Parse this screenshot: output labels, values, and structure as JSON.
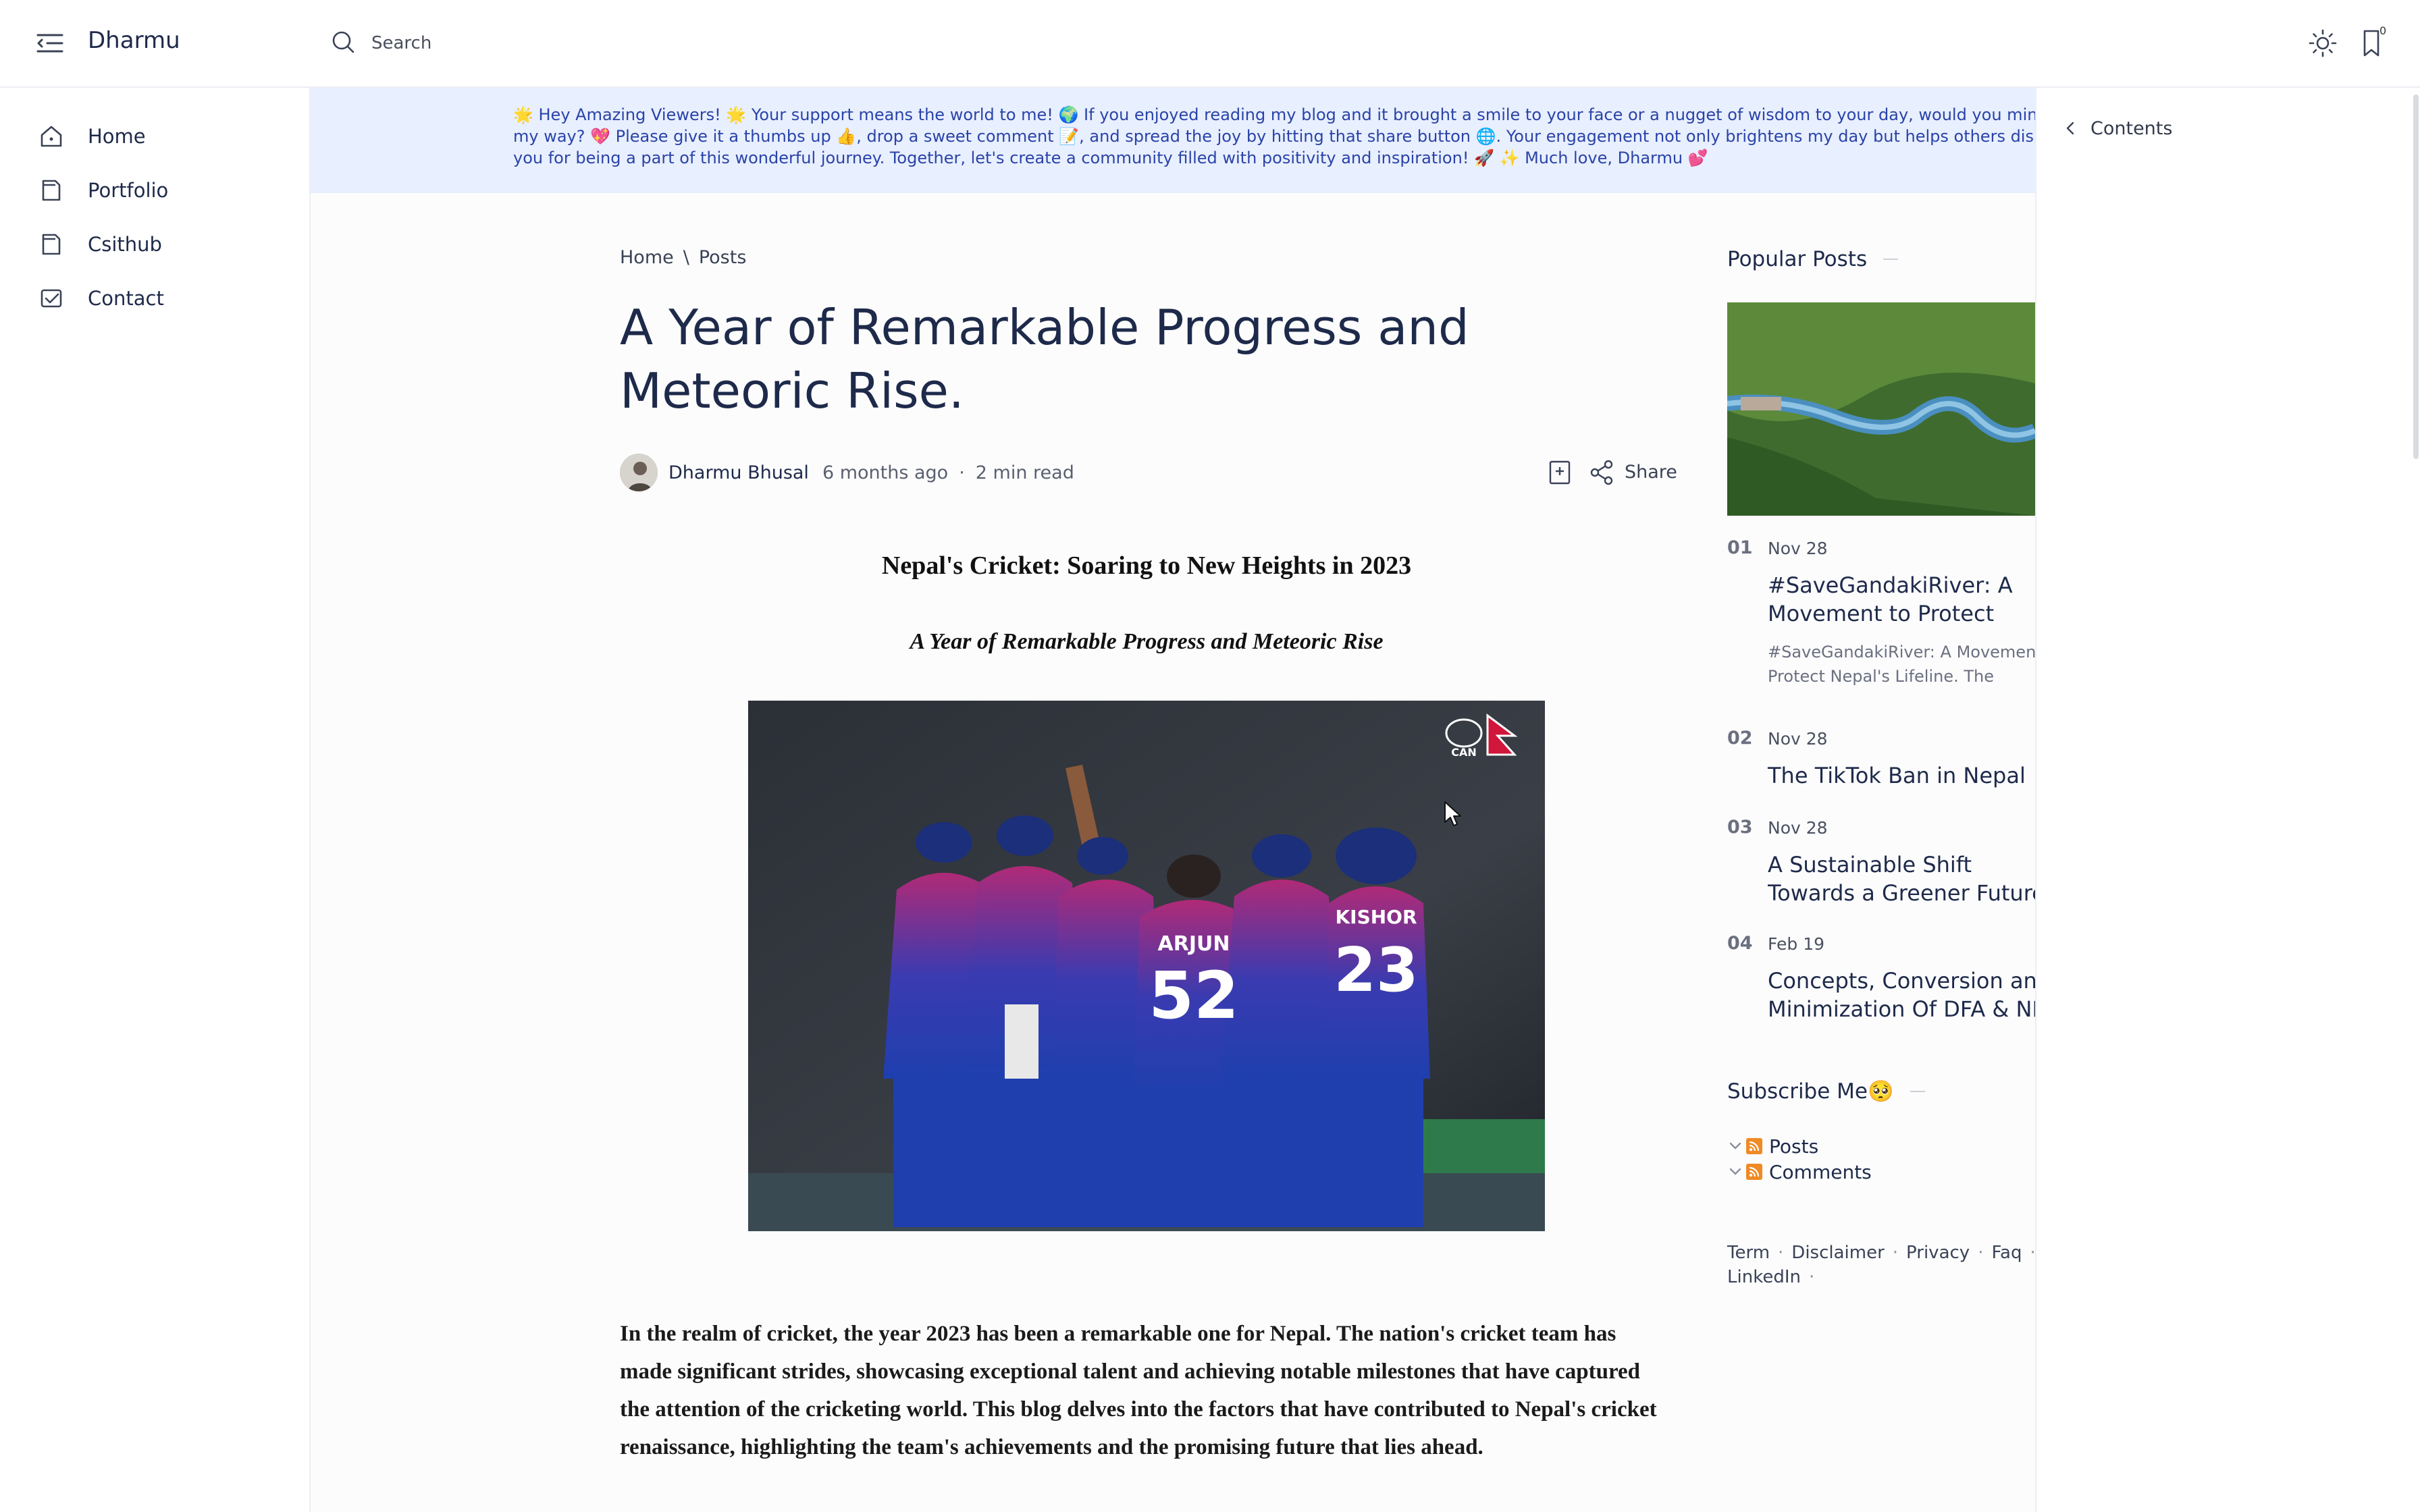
{
  "app": {
    "site_title": "Dharmu",
    "search_placeholder": "Search",
    "bookmark_count": "0"
  },
  "sidebar": {
    "items": [
      {
        "label": "Home",
        "icon": "home-icon"
      },
      {
        "label": "Portfolio",
        "icon": "portfolio-icon"
      },
      {
        "label": "Csithub",
        "icon": "csithub-icon"
      },
      {
        "label": "Contact",
        "icon": "contact-icon"
      }
    ]
  },
  "banner": {
    "text": "🌟 Hey Amazing Viewers! 🌟 Your support means the world to me! 🌍 If you enjoyed reading my blog and it brought a smile to your face or a nugget of wisdom to your day, would you mind sp love my way? 💖 Please give it a thumbs up 👍, drop a sweet comment 📝, and spread the joy by hitting that share button 🌐. Your engagement not only brightens my day but helps others dis too! Thank you for being a part of this wonderful journey. Together, let's create a community filled with positivity and inspiration! 🚀 ✨ Much love, Dharmu 💕"
  },
  "contents": {
    "label": "Contents"
  },
  "article": {
    "breadcrumb": [
      "Home",
      "Posts"
    ],
    "breadcrumb_sep": "\\",
    "title": "A Year of Remarkable Progress and Meteoric Rise.",
    "author": "Dharmu Bhusal",
    "date": "6 months ago",
    "meta_sep": "·",
    "read_time": "2 min read",
    "share_label": "Share",
    "heading": "Nepal's Cricket: Soaring to New Heights in 2023",
    "subheading": "A Year of Remarkable Progress and Meteoric Rise",
    "image": {
      "jersey_numbers": [
        "52",
        "23"
      ],
      "jersey_names": [
        "ARJUN",
        "KISHOR"
      ],
      "badge_text": "CAN"
    },
    "intro": "In the realm of cricket, the year 2023 has been a remarkable one for Nepal. The nation's cricket team has made significant strides, showcasing exceptional talent and achieving notable milestones that have captured the attention of the cricketing world. This blog delves into the factors that have contributed to Nepal's cricket renaissance, highlighting the team's achievements and the promising future that lies ahead."
  },
  "popular": {
    "heading": "Popular Posts",
    "items": [
      {
        "num": "01",
        "date": "Nov 28",
        "title": "#SaveGandakiRiver: A Movement to Protect Nepal's Lifeline",
        "excerpt": "#SaveGandakiRiver: A Movement to Protect Nepal's Lifeline. The Gandaki"
      },
      {
        "num": "02",
        "date": "Nov 28",
        "title": "The TikTok Ban in Nepal",
        "excerpt": ""
      },
      {
        "num": "03",
        "date": "Nov 28",
        "title": "A Sustainable Shift Towards a Greener Future.",
        "excerpt": ""
      },
      {
        "num": "04",
        "date": "Feb 19",
        "title": "Concepts, Conversion and Minimization Of DFA & NFA",
        "excerpt": ""
      }
    ]
  },
  "subscribe": {
    "heading": "Subscribe Me🥺",
    "feeds": [
      "Posts",
      "Comments"
    ]
  },
  "footer": {
    "links": [
      "Term",
      "Disclaimer",
      "Privacy",
      "Faq",
      "LinkedIn"
    ],
    "sep": "·"
  },
  "colors": {
    "banner_bg": "#e8efff",
    "banner_text": "#2a43a8",
    "title": "#1e2a4a",
    "jersey_blue": "#1f3fae",
    "jersey_magenta": "#b02a77"
  }
}
